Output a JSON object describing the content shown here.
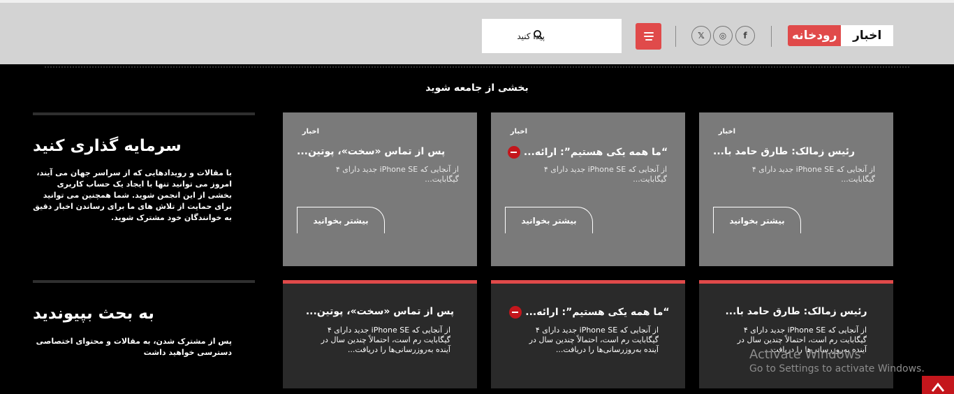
{
  "header": {
    "logo_red": "رودخانه",
    "logo_white": "اخبار",
    "search_placeholder": "پیدا کنید",
    "social": [
      {
        "icon": "facebook-icon",
        "glyph": "f"
      },
      {
        "icon": "instagram-icon",
        "glyph": "◎"
      },
      {
        "icon": "x-twitter-icon",
        "glyph": "𝕏"
      }
    ],
    "accent_color": "#e04a4a"
  },
  "join_title": "بخشی از جامعه شوید",
  "side": {
    "invest_title": "سرمایه گذاری کنید",
    "invest_text": "با مقالات و رویدادهایی که از سراسر جهان می آیند، امروز می توانید تنها با ایجاد یک حساب کاربری بخشی از این انجمن شوید. شما همچنین می توانید برای حمایت از تلاش های ما برای رساندن اخبار دقیق به خوانندگان خود مشترک شوید.",
    "discuss_title": "به بحث بپیوندید",
    "discuss_text": "پس از مشترک شدن، به مقالات و محتوای اختصاصی دسترسی خواهید داشت"
  },
  "top_cards": [
    {
      "category": "اخبار",
      "title": "رئیس زمالک: طارق حامد با...",
      "excerpt": "از آنجایی که iPhone SE جدید دارای ۴ گیگابایت...",
      "read_more": "بیشتر بخوانید",
      "has_icon": false
    },
    {
      "category": "اخبار",
      "title": "“ما همه یکی هستیم”: ارائه...",
      "excerpt": "از آنجایی که iPhone SE جدید دارای ۴ گیگابایت...",
      "read_more": "بیشتر بخوانید",
      "has_icon": true
    },
    {
      "category": "اخبار",
      "title": "پس از تماس «سخت»، پوتین...",
      "excerpt": "از آنجایی که iPhone SE جدید دارای ۴ گیگابایت...",
      "read_more": "بیشتر بخوانید",
      "has_icon": false
    }
  ],
  "bottom_cards": [
    {
      "title": "رئیس زمالک: طارق حامد با...",
      "excerpt": "از آنجایی که iPhone SE جدید دارای ۴ گیگابایت رم است، احتمالاً چندین سال در آینده به‌روزرسانی‌ها را دریافت...",
      "has_icon": false
    },
    {
      "title": "“ما همه یکی هستیم”: ارائه...",
      "excerpt": "از آنجایی که iPhone SE جدید دارای ۴ گیگابایت رم است، احتمالاً چندین سال در آینده به‌روزرسانی‌ها را دریافت...",
      "has_icon": true
    },
    {
      "title": "پس از تماس «سخت»، پوتین...",
      "excerpt": "از آنجایی که iPhone SE جدید دارای ۴ گیگابایت رم است، احتمالاً چندین سال در آینده به‌روزرسانی‌ها را دریافت...",
      "has_icon": false
    }
  ],
  "watermark": {
    "line1": "Activate Windows",
    "line2": "Go to Settings to activate Windows."
  }
}
